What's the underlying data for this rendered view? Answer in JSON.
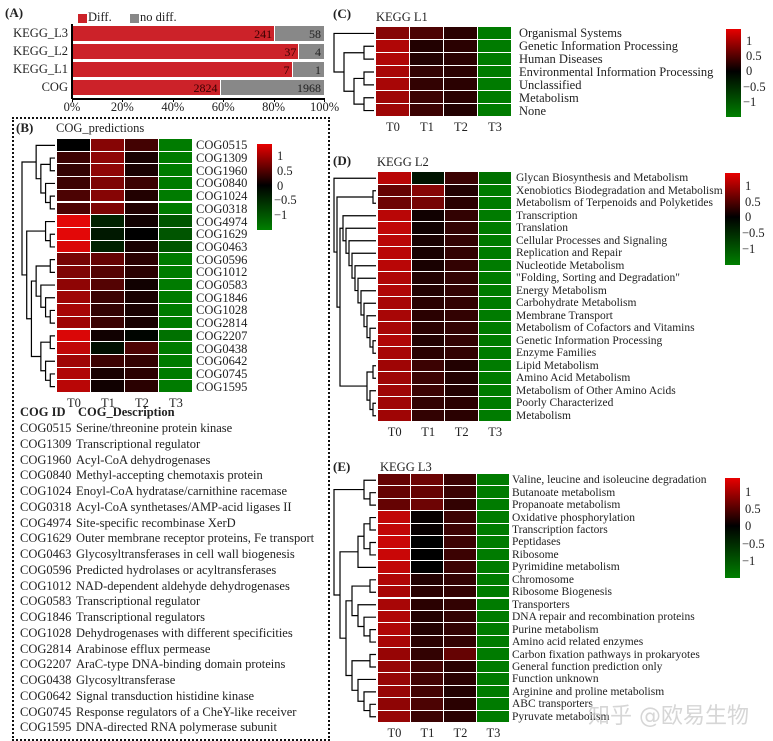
{
  "panelA": {
    "label": "(A)",
    "legend": [
      {
        "name": "Diff.",
        "color": "#cc2229"
      },
      {
        "name": "no diff.",
        "color": "#888888"
      }
    ],
    "chart_data": {
      "type": "bar",
      "orientation": "horizontal",
      "stacked": "percent",
      "categories": [
        "KEGG_L3",
        "KEGG_L2",
        "KEGG_L1",
        "COG"
      ],
      "series": [
        {
          "name": "Diff.",
          "values": [
            241,
            37,
            7,
            2824
          ]
        },
        {
          "name": "no diff.",
          "values": [
            58,
            4,
            1,
            1968
          ]
        }
      ],
      "xticks": [
        "0%",
        "20%",
        "40%",
        "60%",
        "80%",
        "100%"
      ],
      "xlim": [
        0,
        100
      ]
    }
  },
  "panelB": {
    "label": "(B)",
    "title": "COG_predictions",
    "chart_data": {
      "type": "heatmap",
      "columns": [
        "T0",
        "T1",
        "T2",
        "T3"
      ],
      "rows": [
        "COG0515",
        "COG1309",
        "COG1960",
        "COG0840",
        "COG1024",
        "COG0318",
        "COG4974",
        "COG1629",
        "COG0463",
        "COG0596",
        "COG1012",
        "COG0583",
        "COG1846",
        "COG1028",
        "COG2814",
        "COG2207",
        "COG0438",
        "COG0642",
        "COG0745",
        "COG1595"
      ],
      "values": [
        [
          0.0,
          0.8,
          0.4,
          -1.3
        ],
        [
          0.35,
          0.85,
          0.15,
          -1.3
        ],
        [
          0.3,
          0.85,
          0.15,
          -1.3
        ],
        [
          0.35,
          0.75,
          0.35,
          -1.3
        ],
        [
          0.45,
          0.8,
          0.2,
          -1.3
        ],
        [
          0.45,
          0.75,
          0.2,
          -1.3
        ],
        [
          1.35,
          -0.35,
          0.1,
          -0.9
        ],
        [
          1.35,
          -0.25,
          0.0,
          -0.9
        ],
        [
          1.3,
          -0.35,
          0.15,
          -0.9
        ],
        [
          0.7,
          0.6,
          0.25,
          -1.3
        ],
        [
          0.75,
          0.5,
          0.25,
          -1.3
        ],
        [
          0.85,
          0.5,
          0.1,
          -1.3
        ],
        [
          0.95,
          0.35,
          0.15,
          -1.3
        ],
        [
          1.0,
          0.3,
          0.15,
          -1.3
        ],
        [
          0.95,
          0.35,
          0.15,
          -1.3
        ],
        [
          1.3,
          0.1,
          -0.05,
          -1.2
        ],
        [
          1.15,
          -0.15,
          0.45,
          -1.3
        ],
        [
          0.95,
          0.35,
          0.3,
          -1.3
        ],
        [
          1.05,
          0.15,
          0.25,
          -1.3
        ],
        [
          1.1,
          0.1,
          0.25,
          -1.3
        ]
      ],
      "colorbar_ticks": [
        "1",
        "0.5",
        "0",
        "-0.5",
        "-1"
      ],
      "colorbar_range": [
        -1.5,
        1.4
      ],
      "colors": {
        "high": "#e80000",
        "mid": "#000000",
        "low": "#008000"
      }
    },
    "table": {
      "header": {
        "id": "COG ID",
        "desc": "COG_Description"
      },
      "rows": [
        {
          "id": "COG0515",
          "desc": "Serine/threonine protein kinase"
        },
        {
          "id": "COG1309",
          "desc": "Transcriptional regulator"
        },
        {
          "id": "COG1960",
          "desc": "Acyl-CoA dehydrogenases"
        },
        {
          "id": "COG0840",
          "desc": "Methyl-accepting chemotaxis protein"
        },
        {
          "id": "COG1024",
          "desc": "Enoyl-CoA hydratase/carnithine racemase"
        },
        {
          "id": "COG0318",
          "desc": "Acyl-CoA synthetases/AMP-acid ligases II"
        },
        {
          "id": "COG4974",
          "desc": "Site-specific recombinase XerD"
        },
        {
          "id": "COG1629",
          "desc": "Outer membrane receptor proteins, Fe transport"
        },
        {
          "id": "COG0463",
          "desc": "Glycosyltransferases in cell wall biogenesis"
        },
        {
          "id": "COG0596",
          "desc": "Predicted hydrolases or acyltransferases"
        },
        {
          "id": "COG1012",
          "desc": "NAD-dependent aldehyde dehydrogenases"
        },
        {
          "id": "COG0583",
          "desc": "Transcriptional regulator"
        },
        {
          "id": "COG1846",
          "desc": "Transcriptional regulators"
        },
        {
          "id": "COG1028",
          "desc": "Dehydrogenases with different specificities"
        },
        {
          "id": "COG2814",
          "desc": "Arabinose efflux permease"
        },
        {
          "id": "COG2207",
          "desc": "AraC-type DNA-binding domain proteins"
        },
        {
          "id": "COG0438",
          "desc": "Glycosyltransferase"
        },
        {
          "id": "COG0642",
          "desc": "Signal transduction histidine kinase"
        },
        {
          "id": "COG0745",
          "desc": "Response regulators of a CheY-like receiver"
        },
        {
          "id": "COG1595",
          "desc": "DNA-directed RNA polymerase subunit"
        }
      ]
    }
  },
  "panelC": {
    "label": "(C)",
    "title": "KEGG L1",
    "chart_data": {
      "type": "heatmap",
      "columns": [
        "T0",
        "T1",
        "T2",
        "T3"
      ],
      "rows": [
        "Organismal Systems",
        "Genetic Information Processing",
        "Human Diseases",
        "Environmental Information Processing",
        "Unclassified",
        "Metabolism",
        "None"
      ],
      "values": [
        [
          0.8,
          0.45,
          0.25,
          -1.3
        ],
        [
          1.05,
          0.2,
          0.25,
          -1.3
        ],
        [
          1.05,
          0.2,
          0.25,
          -1.3
        ],
        [
          1.0,
          0.3,
          0.25,
          -1.3
        ],
        [
          1.0,
          0.3,
          0.25,
          -1.3
        ],
        [
          0.95,
          0.35,
          0.25,
          -1.3
        ],
        [
          0.95,
          0.35,
          0.2,
          -1.3
        ]
      ],
      "colorbar_ticks": [
        "1",
        "0.5",
        "0",
        "-0.5",
        "-1"
      ],
      "colorbar_range": [
        -1.5,
        1.4
      ]
    }
  },
  "panelD": {
    "label": "(D)",
    "title": "KEGG L2",
    "chart_data": {
      "type": "heatmap",
      "columns": [
        "T0",
        "T1",
        "T2",
        "T3"
      ],
      "rows": [
        "Glycan Biosynthesis and Metabolism",
        "Xenobiotics Biodegradation and Metabolism",
        "Metabolism of Terpenoids and Polyketides",
        "Transcription",
        "Translation",
        "Cellular Processes and Signaling",
        "Replication and Repair",
        "Nucleotide Metabolism",
        "\"Folding, Sorting and Degradation\"",
        "Energy Metabolism",
        "Carbohydrate Metabolism",
        "Membrane Transport",
        "Metabolism of Cofactors and Vitamins",
        "Genetic Information Processing",
        "Enzyme Families",
        "Lipid Metabolism",
        "Amino Acid Metabolism",
        "Metabolism of Other Amino Acids",
        "Poorly Characterized",
        "Metabolism"
      ],
      "values": [
        [
          1.1,
          -0.2,
          0.35,
          -1.2
        ],
        [
          0.6,
          0.8,
          0.2,
          -1.3
        ],
        [
          0.65,
          0.7,
          0.25,
          -1.3
        ],
        [
          1.1,
          0.1,
          0.3,
          -1.3
        ],
        [
          1.15,
          0.1,
          0.3,
          -1.3
        ],
        [
          1.1,
          0.15,
          0.3,
          -1.3
        ],
        [
          1.1,
          0.15,
          0.3,
          -1.3
        ],
        [
          1.1,
          0.15,
          0.3,
          -1.3
        ],
        [
          1.05,
          0.2,
          0.3,
          -1.3
        ],
        [
          1.05,
          0.2,
          0.3,
          -1.3
        ],
        [
          1.0,
          0.25,
          0.3,
          -1.3
        ],
        [
          1.0,
          0.25,
          0.3,
          -1.3
        ],
        [
          1.0,
          0.25,
          0.3,
          -1.3
        ],
        [
          1.05,
          0.2,
          0.3,
          -1.3
        ],
        [
          1.0,
          0.25,
          0.3,
          -1.3
        ],
        [
          0.95,
          0.35,
          0.2,
          -1.3
        ],
        [
          0.95,
          0.35,
          0.2,
          -1.3
        ],
        [
          0.95,
          0.35,
          0.2,
          -1.3
        ],
        [
          0.95,
          0.3,
          0.25,
          -1.3
        ],
        [
          0.95,
          0.3,
          0.25,
          -1.3
        ]
      ],
      "colorbar_ticks": [
        "1",
        "0.5",
        "0",
        "-0.5",
        "-1"
      ],
      "colorbar_range": [
        -1.5,
        1.4
      ]
    }
  },
  "panelE": {
    "label": "(E)",
    "title": "KEGG L3",
    "chart_data": {
      "type": "heatmap",
      "columns": [
        "T0",
        "T1",
        "T2",
        "T3"
      ],
      "rows": [
        "Valine, leucine and isoleucine degradation",
        "Butanoate metabolism",
        "Propanoate metabolism",
        "Oxidative phosphorylation",
        "Transcription factors",
        "Peptidases",
        "Ribosome",
        "Pyrimidine metabolism",
        "Chromosome",
        "Ribosome Biogenesis",
        "Transporters",
        "DNA repair and recombination proteins",
        "Purine metabolism",
        "Amino acid related enzymes",
        "Carbon fixation pathways in prokaryotes",
        "General function prediction only",
        "Function unknown",
        "Arginine and proline metabolism",
        "ABC transporters",
        "Pyruvate metabolism"
      ],
      "values": [
        [
          0.6,
          0.65,
          0.35,
          -1.3
        ],
        [
          0.6,
          0.6,
          0.35,
          -1.3
        ],
        [
          0.6,
          0.65,
          0.3,
          -1.3
        ],
        [
          1.15,
          0.05,
          0.35,
          -1.3
        ],
        [
          1.15,
          0.05,
          0.35,
          -1.3
        ],
        [
          1.2,
          0.0,
          0.35,
          -1.3
        ],
        [
          1.2,
          0.0,
          0.35,
          -1.3
        ],
        [
          1.15,
          0.0,
          0.35,
          -1.3
        ],
        [
          1.05,
          0.2,
          0.3,
          -1.3
        ],
        [
          1.0,
          0.25,
          0.3,
          -1.3
        ],
        [
          1.0,
          0.25,
          0.3,
          -1.3
        ],
        [
          1.05,
          0.2,
          0.3,
          -1.3
        ],
        [
          1.05,
          0.2,
          0.3,
          -1.3
        ],
        [
          1.0,
          0.25,
          0.3,
          -1.3
        ],
        [
          0.9,
          0.3,
          0.6,
          -1.3
        ],
        [
          0.9,
          0.4,
          0.25,
          -1.3
        ],
        [
          0.9,
          0.4,
          0.25,
          -1.3
        ],
        [
          0.9,
          0.4,
          0.2,
          -1.3
        ],
        [
          0.85,
          0.45,
          0.25,
          -1.3
        ],
        [
          0.9,
          0.35,
          0.25,
          -1.3
        ]
      ],
      "colorbar_ticks": [
        "1",
        "0.5",
        "0",
        "-0.5",
        "-1"
      ],
      "colorbar_range": [
        -1.5,
        1.4
      ]
    }
  },
  "watermark": "知乎 @欧易生物"
}
